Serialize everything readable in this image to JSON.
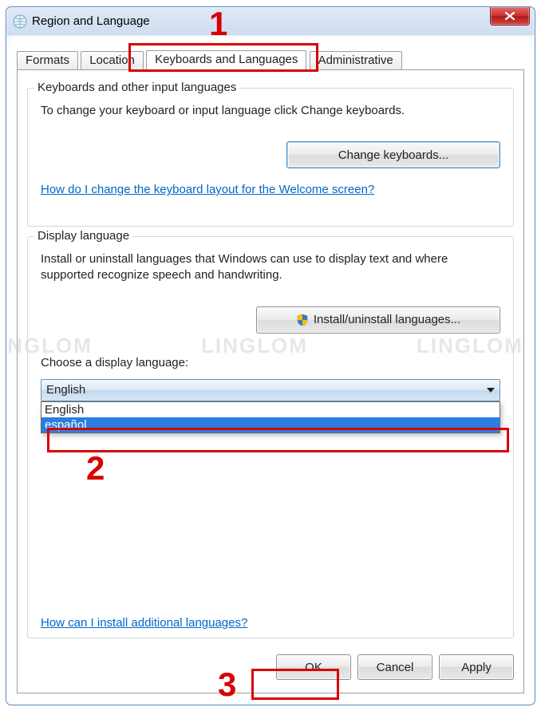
{
  "window": {
    "title": "Region and Language"
  },
  "tabs": {
    "formats": "Formats",
    "location": "Location",
    "keyboards": "Keyboards and Languages",
    "admin": "Administrative"
  },
  "group1": {
    "legend": "Keyboards and other input languages",
    "desc": "To change your keyboard or input language click Change keyboards.",
    "btn": "Change keyboards...",
    "link": "How do I change the keyboard layout for the Welcome screen?"
  },
  "group2": {
    "legend": "Display language",
    "desc": "Install or uninstall languages that Windows can use to display text and where supported recognize speech and handwriting.",
    "btn": "Install/uninstall languages...",
    "choose": "Choose a display language:",
    "selected": "English",
    "options": {
      "english": "English",
      "espanol": "español"
    },
    "link": "How can I install additional languages?"
  },
  "buttons": {
    "ok": "OK",
    "cancel": "Cancel",
    "apply": "Apply"
  },
  "annotations": {
    "n1": "1",
    "n2": "2",
    "n3": "3"
  },
  "watermark": "LINGLOM"
}
